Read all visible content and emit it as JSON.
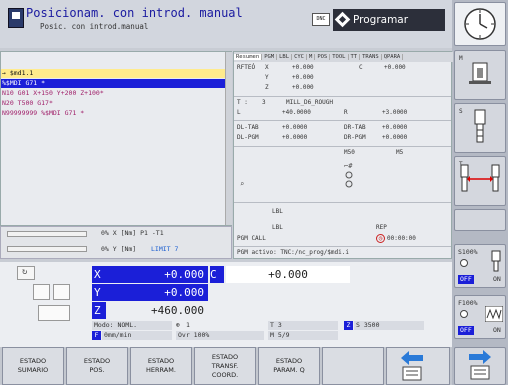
{
  "header": {
    "title": "Posicionam. con introd. manual",
    "subtitle": "Posic. con introd.manual",
    "dnc": "DNC",
    "mode": "Programar"
  },
  "program": {
    "lines": [
      "→ $md1.1",
      "%$MDI G71 *",
      "N10 G01 X+150 Y+200 Z+100*",
      "N20 T500 G17*",
      "N99999999 %$MDI G71 *"
    ]
  },
  "status": {
    "tabs": [
      "Resumen",
      "PGM",
      "LBL",
      "CYC",
      "M",
      "POS",
      "TOOL",
      "TT",
      "TRANS",
      "QPARA"
    ],
    "rfteo": "RFTEÓ",
    "x_label": "X",
    "x_val": "+0.000",
    "c_label": "C",
    "c_val": "+0.000",
    "y_label": "Y",
    "y_val": "+0.000",
    "z_label": "Z",
    "z_val": "+0.000",
    "t_label": "T :",
    "t_num": "3",
    "t_name": "MILL_D6_ROUGH",
    "l_label": "L",
    "l_val": "+40.0000",
    "r_label": "R",
    "r_val": "+3.0000",
    "dltab": "DL-TAB",
    "dltab_val": "+0.0000",
    "drtab": "DR-TAB",
    "drtab_val": "+0.0000",
    "dlpgm": "DL-PGM",
    "dlpgm_val": "+0.0000",
    "drpgm": "DR-PGM",
    "drpgm_val": "+0.0000",
    "m50": "M50",
    "m5": "M5",
    "lbl1": "LBL",
    "lbl2": "LBL",
    "rep": "REP",
    "pgm_call": "PGM CALL",
    "time": "00:00:00",
    "pgm_activo": "PGM activo: TNC:/nc_prog/$mdi.i"
  },
  "feed": {
    "x_line": "0% X [Nm]  P1  -T1",
    "y_line": "0% Y [Nm]",
    "limit": "LIMIT 7"
  },
  "positions": {
    "x_axis": "X",
    "x_val": "+0.000",
    "c_axis": "C",
    "c_val": "+0.000",
    "y_axis": "Y",
    "y_val": "+0.000",
    "z_axis": "Z",
    "z_val": "+460.000",
    "modo": "Modo: NOML.",
    "t3": "T 3",
    "s_val": "S 3500",
    "feed": "0mm/min",
    "ovr": "Ovr 100%",
    "m": "M 5/9",
    "cam": "1",
    "z_badge": "Z",
    "f_badge": "F"
  },
  "softkeys": [
    [
      "ESTADO",
      "SUMARIO"
    ],
    [
      "ESTADO",
      "POS."
    ],
    [
      "ESTADO",
      "HERRAM."
    ],
    [
      "ESTADO",
      "TRANSF.",
      "COORD."
    ],
    [
      "ESTADO",
      "PARAM. Q"
    ],
    [
      ""
    ],
    [
      ""
    ]
  ],
  "sidekeys": {
    "m": "M",
    "s": "S",
    "t": "T",
    "s100": "S100%",
    "off1": "OFF",
    "on1": "ON",
    "f100": "F100%",
    "off2": "OFF",
    "on2": "ON"
  },
  "colors": {
    "axis_blue": "#1b1fd8",
    "sel_blue": "#1b1fd8",
    "prog_bg": "#2c2f3a"
  }
}
